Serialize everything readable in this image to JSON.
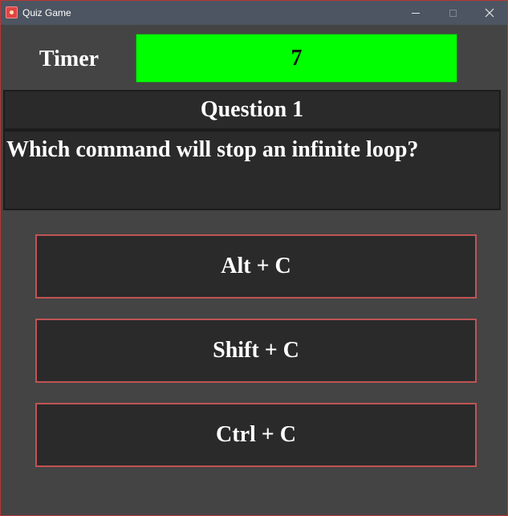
{
  "window": {
    "title": "Quiz Game",
    "icon": "quiz-app-icon"
  },
  "timer": {
    "label": "Timer",
    "value": "7",
    "color": "#00ff00"
  },
  "question": {
    "header": "Question 1",
    "text": "Which command will stop an infinite loop?"
  },
  "answers": [
    {
      "label": "Alt + C"
    },
    {
      "label": "Shift + C"
    },
    {
      "label": "Ctrl + C"
    }
  ],
  "colors": {
    "background": "#444444",
    "panel": "#2a2a2a",
    "answer_border": "#c05454",
    "titlebar": "#4c5561"
  }
}
